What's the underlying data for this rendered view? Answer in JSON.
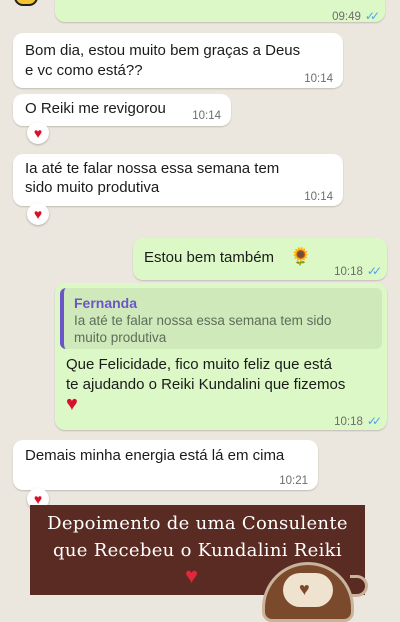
{
  "chat": {
    "messages": [
      {
        "type": "outgoing",
        "time": "09:49",
        "status": "read"
      },
      {
        "type": "incoming",
        "line1": "Bom dia, estou muito bem graças a Deus",
        "line2": "e vc como está??",
        "time": "10:14"
      },
      {
        "type": "incoming",
        "line1": "O Reiki me revigorou",
        "time": "10:14",
        "reaction": "heart"
      },
      {
        "type": "incoming",
        "line1": "Ia até te falar nossa essa semana tem",
        "line2": "sido muito produtiva",
        "time": "10:14",
        "reaction": "heart"
      },
      {
        "type": "outgoing",
        "line1": "Estou bem também",
        "emoji": "🌻",
        "time": "10:18",
        "status": "read"
      },
      {
        "type": "outgoing_reply",
        "quote_author": "Fernanda",
        "quote_line1": "Ia até te falar nossa essa semana tem sido",
        "quote_line2": "muito produtiva",
        "line1": "Que Felicidade, fico muito feliz que está",
        "line2": "te ajudando o Reiki Kundalini que fizemos",
        "emoji": "❤️",
        "time": "10:18",
        "status": "read"
      },
      {
        "type": "incoming",
        "line1": "Demais minha energia está lá em cima",
        "time": "10:21",
        "reaction": "heart"
      }
    ]
  },
  "banner": {
    "line1": "Depoimento de uma Consulente",
    "line2": "que Recebeu o Kundalini Reiki",
    "heart": "❤️"
  },
  "colors": {
    "background": "#ebe6de",
    "incoming_bubble": "#ffffff",
    "outgoing_bubble": "#dcf8c6",
    "read_ticks": "#4fa3e8",
    "quote_author": "#6b55c7",
    "banner": "#5a2b23"
  }
}
